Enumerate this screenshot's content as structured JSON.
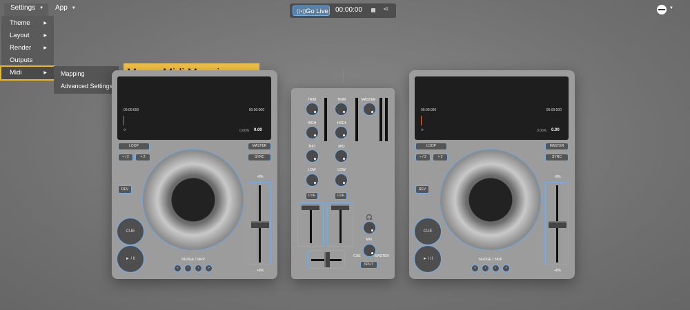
{
  "menubar": {
    "settings_label": "Settings",
    "app_label": "App",
    "dropdown": [
      {
        "label": "Theme"
      },
      {
        "label": "Layout"
      },
      {
        "label": "Render"
      },
      {
        "label": "Outputs"
      },
      {
        "label": "Midi"
      }
    ],
    "submenu": [
      {
        "label": "Mapping"
      },
      {
        "label": "Advanced Settings"
      }
    ]
  },
  "callout": {
    "text": "Menu: Midi Mapping"
  },
  "topbar": {
    "go_live": "Go Live",
    "timer": "00:00:00"
  },
  "deck": {
    "time_elapsed": "00:00:000",
    "time_remaining": "00:00:000",
    "pitch_pct": "0.00%",
    "bpm": "0.00",
    "loop": "LOOP",
    "half": "÷ / 2",
    "double": "× 2",
    "master": "MASTER",
    "sync": "SYNC",
    "rev": "REV",
    "cue": "CUE",
    "play_pause": "► / II",
    "nudge_label": "NUDGE / SKIP",
    "pitch_top": "-8%",
    "pitch_bottom": "+8%"
  },
  "mixer": {
    "trim": "TRIM",
    "high": "HIGH",
    "mid": "MID",
    "low": "LOW",
    "cue": "CUE",
    "master": "MASTER",
    "mix": "MIX",
    "cue_side": "CUE",
    "master_side": "MASTER",
    "split": "SPLIT"
  },
  "colors": {
    "accent_blue": "#74aeea",
    "highlight_yellow": "#f3c244",
    "marker_orange": "#e06a3b"
  }
}
